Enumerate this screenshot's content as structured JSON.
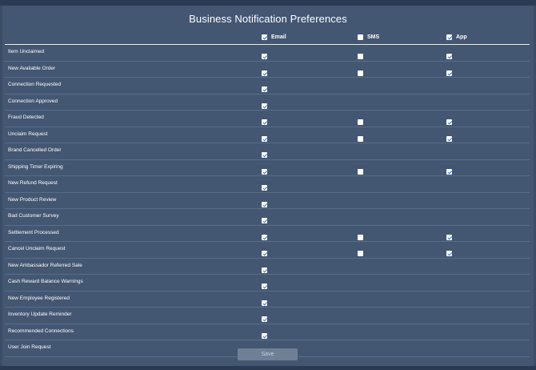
{
  "page": {
    "title": "Business Notification Preferences"
  },
  "columns": {
    "email": "Email",
    "sms": "SMS",
    "app": "App"
  },
  "header_checks": {
    "email": true,
    "sms": false,
    "app": true
  },
  "rows": [
    {
      "label": "Item Unclaimed",
      "email": true,
      "sms": false,
      "app": true
    },
    {
      "label": "New Available Order",
      "email": true,
      "sms": false,
      "app": true
    },
    {
      "label": "Connection Requested",
      "email": true,
      "sms": null,
      "app": null
    },
    {
      "label": "Connection Approved",
      "email": true,
      "sms": null,
      "app": null
    },
    {
      "label": "Fraud Detected",
      "email": true,
      "sms": false,
      "app": true
    },
    {
      "label": "Unclaim Request",
      "email": true,
      "sms": false,
      "app": true
    },
    {
      "label": "Brand Cancelled Order",
      "email": true,
      "sms": null,
      "app": null
    },
    {
      "label": "Shipping Timer Expiring",
      "email": true,
      "sms": false,
      "app": true
    },
    {
      "label": "New Refund Request",
      "email": true,
      "sms": null,
      "app": null
    },
    {
      "label": "New Product Review",
      "email": true,
      "sms": null,
      "app": null
    },
    {
      "label": "Bad Customer Survey",
      "email": true,
      "sms": null,
      "app": null
    },
    {
      "label": "Settlement Processed",
      "email": true,
      "sms": false,
      "app": true
    },
    {
      "label": "Cancel Unclaim Request",
      "email": true,
      "sms": false,
      "app": true
    },
    {
      "label": "New Ambassador Referred Sale",
      "email": true,
      "sms": null,
      "app": null
    },
    {
      "label": "Cash Reward Balance Warnings",
      "email": true,
      "sms": null,
      "app": null
    },
    {
      "label": "New Employee Registered",
      "email": true,
      "sms": null,
      "app": null
    },
    {
      "label": "Inventory Update Reminder",
      "email": true,
      "sms": null,
      "app": null
    },
    {
      "label": "Recommended Connections",
      "email": true,
      "sms": null,
      "app": null
    },
    {
      "label": "User Join Request",
      "email": true,
      "sms": null,
      "app": null
    }
  ],
  "actions": {
    "save_label": "Save"
  }
}
